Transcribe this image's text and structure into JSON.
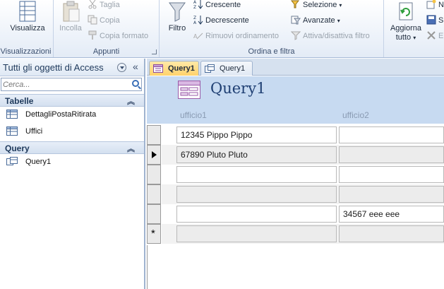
{
  "ribbon": {
    "groups": {
      "views": {
        "label": "Visualizzazioni",
        "view_button": "Visualizza"
      },
      "clipboard": {
        "label": "Appunti",
        "paste": "Incolla",
        "cut": "Taglia",
        "copy": "Copia",
        "format_painter": "Copia formato"
      },
      "sort_filter": {
        "label": "Ordina e filtra",
        "filter": "Filtro",
        "ascending": "Crescente",
        "descending": "Decrescente",
        "remove_sort": "Rimuovi ordinamento",
        "selection": "Selezione",
        "advanced": "Avanzate",
        "toggle_filter": "Attiva/disattiva filtro"
      },
      "records": {
        "refresh_line1": "Aggiorna",
        "refresh_line2": "tutto",
        "new_partial": "N",
        "save_partial": "S",
        "delete_partial": "E"
      }
    }
  },
  "nav_pane": {
    "title": "Tutti gli oggetti di Access",
    "search_placeholder": "Cerca...",
    "sections": [
      {
        "label": "Tabelle",
        "items": [
          "DettagliPostaRitirata",
          "Uffici"
        ]
      },
      {
        "label": "Query",
        "items": [
          "Query1"
        ]
      }
    ]
  },
  "document": {
    "tabs": [
      {
        "label": "Query1",
        "active": true
      },
      {
        "label": "Query1",
        "active": false
      }
    ],
    "form_title": "Query1",
    "columns": [
      "ufficio1",
      "ufficio2"
    ],
    "rows": [
      {
        "ufficio1": "12345 Pippo Pippo",
        "ufficio2": ""
      },
      {
        "ufficio1": "67890 Pluto Pluto",
        "ufficio2": ""
      },
      {
        "ufficio1": "",
        "ufficio2": ""
      },
      {
        "ufficio1": "",
        "ufficio2": ""
      },
      {
        "ufficio1": "",
        "ufficio2": "34567 eee eee"
      },
      {
        "ufficio1": "",
        "ufficio2": ""
      }
    ]
  },
  "colors": {
    "ribbon_bg": "#e3ebf6",
    "form_header": "#c7daf1",
    "active_tab": "#ffd26b",
    "title_text": "#1f3f73"
  }
}
